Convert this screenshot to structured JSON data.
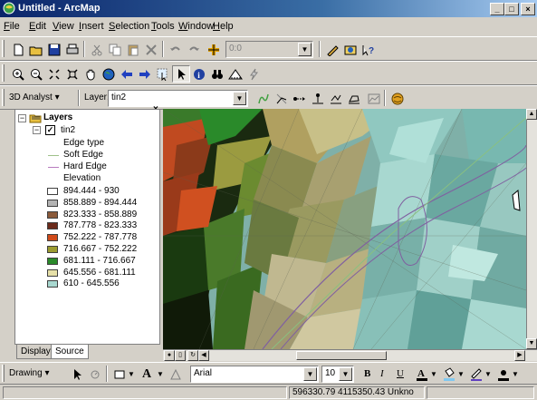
{
  "window": {
    "title": "Untitled - ArcMap",
    "minimize": "_",
    "maximize": "□",
    "close": "×"
  },
  "menu": [
    "File",
    "Edit",
    "View",
    "Insert",
    "Selection",
    "Tools",
    "Window",
    "Help"
  ],
  "standard_toolbar": {
    "scale_value": "0:0"
  },
  "analyst_toolbar": {
    "analyst_label": "3D Analyst ▾",
    "layer_label": "Layer:",
    "layer_value": "tin2"
  },
  "toc": {
    "root": "Layers",
    "layer": "tin2",
    "edge_heading": "Edge type",
    "edges": [
      {
        "label": "Soft Edge",
        "color": "#9fc18a"
      },
      {
        "label": "Hard Edge",
        "color": "#b87bbf"
      }
    ],
    "elevation_heading": "Elevation",
    "classes": [
      {
        "label": "894.444 - 930",
        "color": "#ffffff"
      },
      {
        "label": "858.889 - 894.444",
        "color": "#b4b4b4"
      },
      {
        "label": "823.333 - 858.889",
        "color": "#8b5a3a"
      },
      {
        "label": "787.778 - 823.333",
        "color": "#6b2a1a"
      },
      {
        "label": "752.222 - 787.778",
        "color": "#d04a1a"
      },
      {
        "label": "716.667 - 752.222",
        "color": "#9b9b30"
      },
      {
        "label": "681.111 - 716.667",
        "color": "#2a8a2a"
      },
      {
        "label": "645.556 - 681.111",
        "color": "#e6e0a8"
      },
      {
        "label": "610 - 645.556",
        "color": "#a8d8d0"
      }
    ],
    "tabs": [
      "Display",
      "Source"
    ]
  },
  "drawing_toolbar": {
    "drawing_label": "Drawing ▾",
    "font": "Arial",
    "font_size": "10",
    "bold": "B",
    "italic": "I",
    "underline": "U"
  },
  "status": {
    "coords": "596330.79  4115350.43 Unkno"
  }
}
